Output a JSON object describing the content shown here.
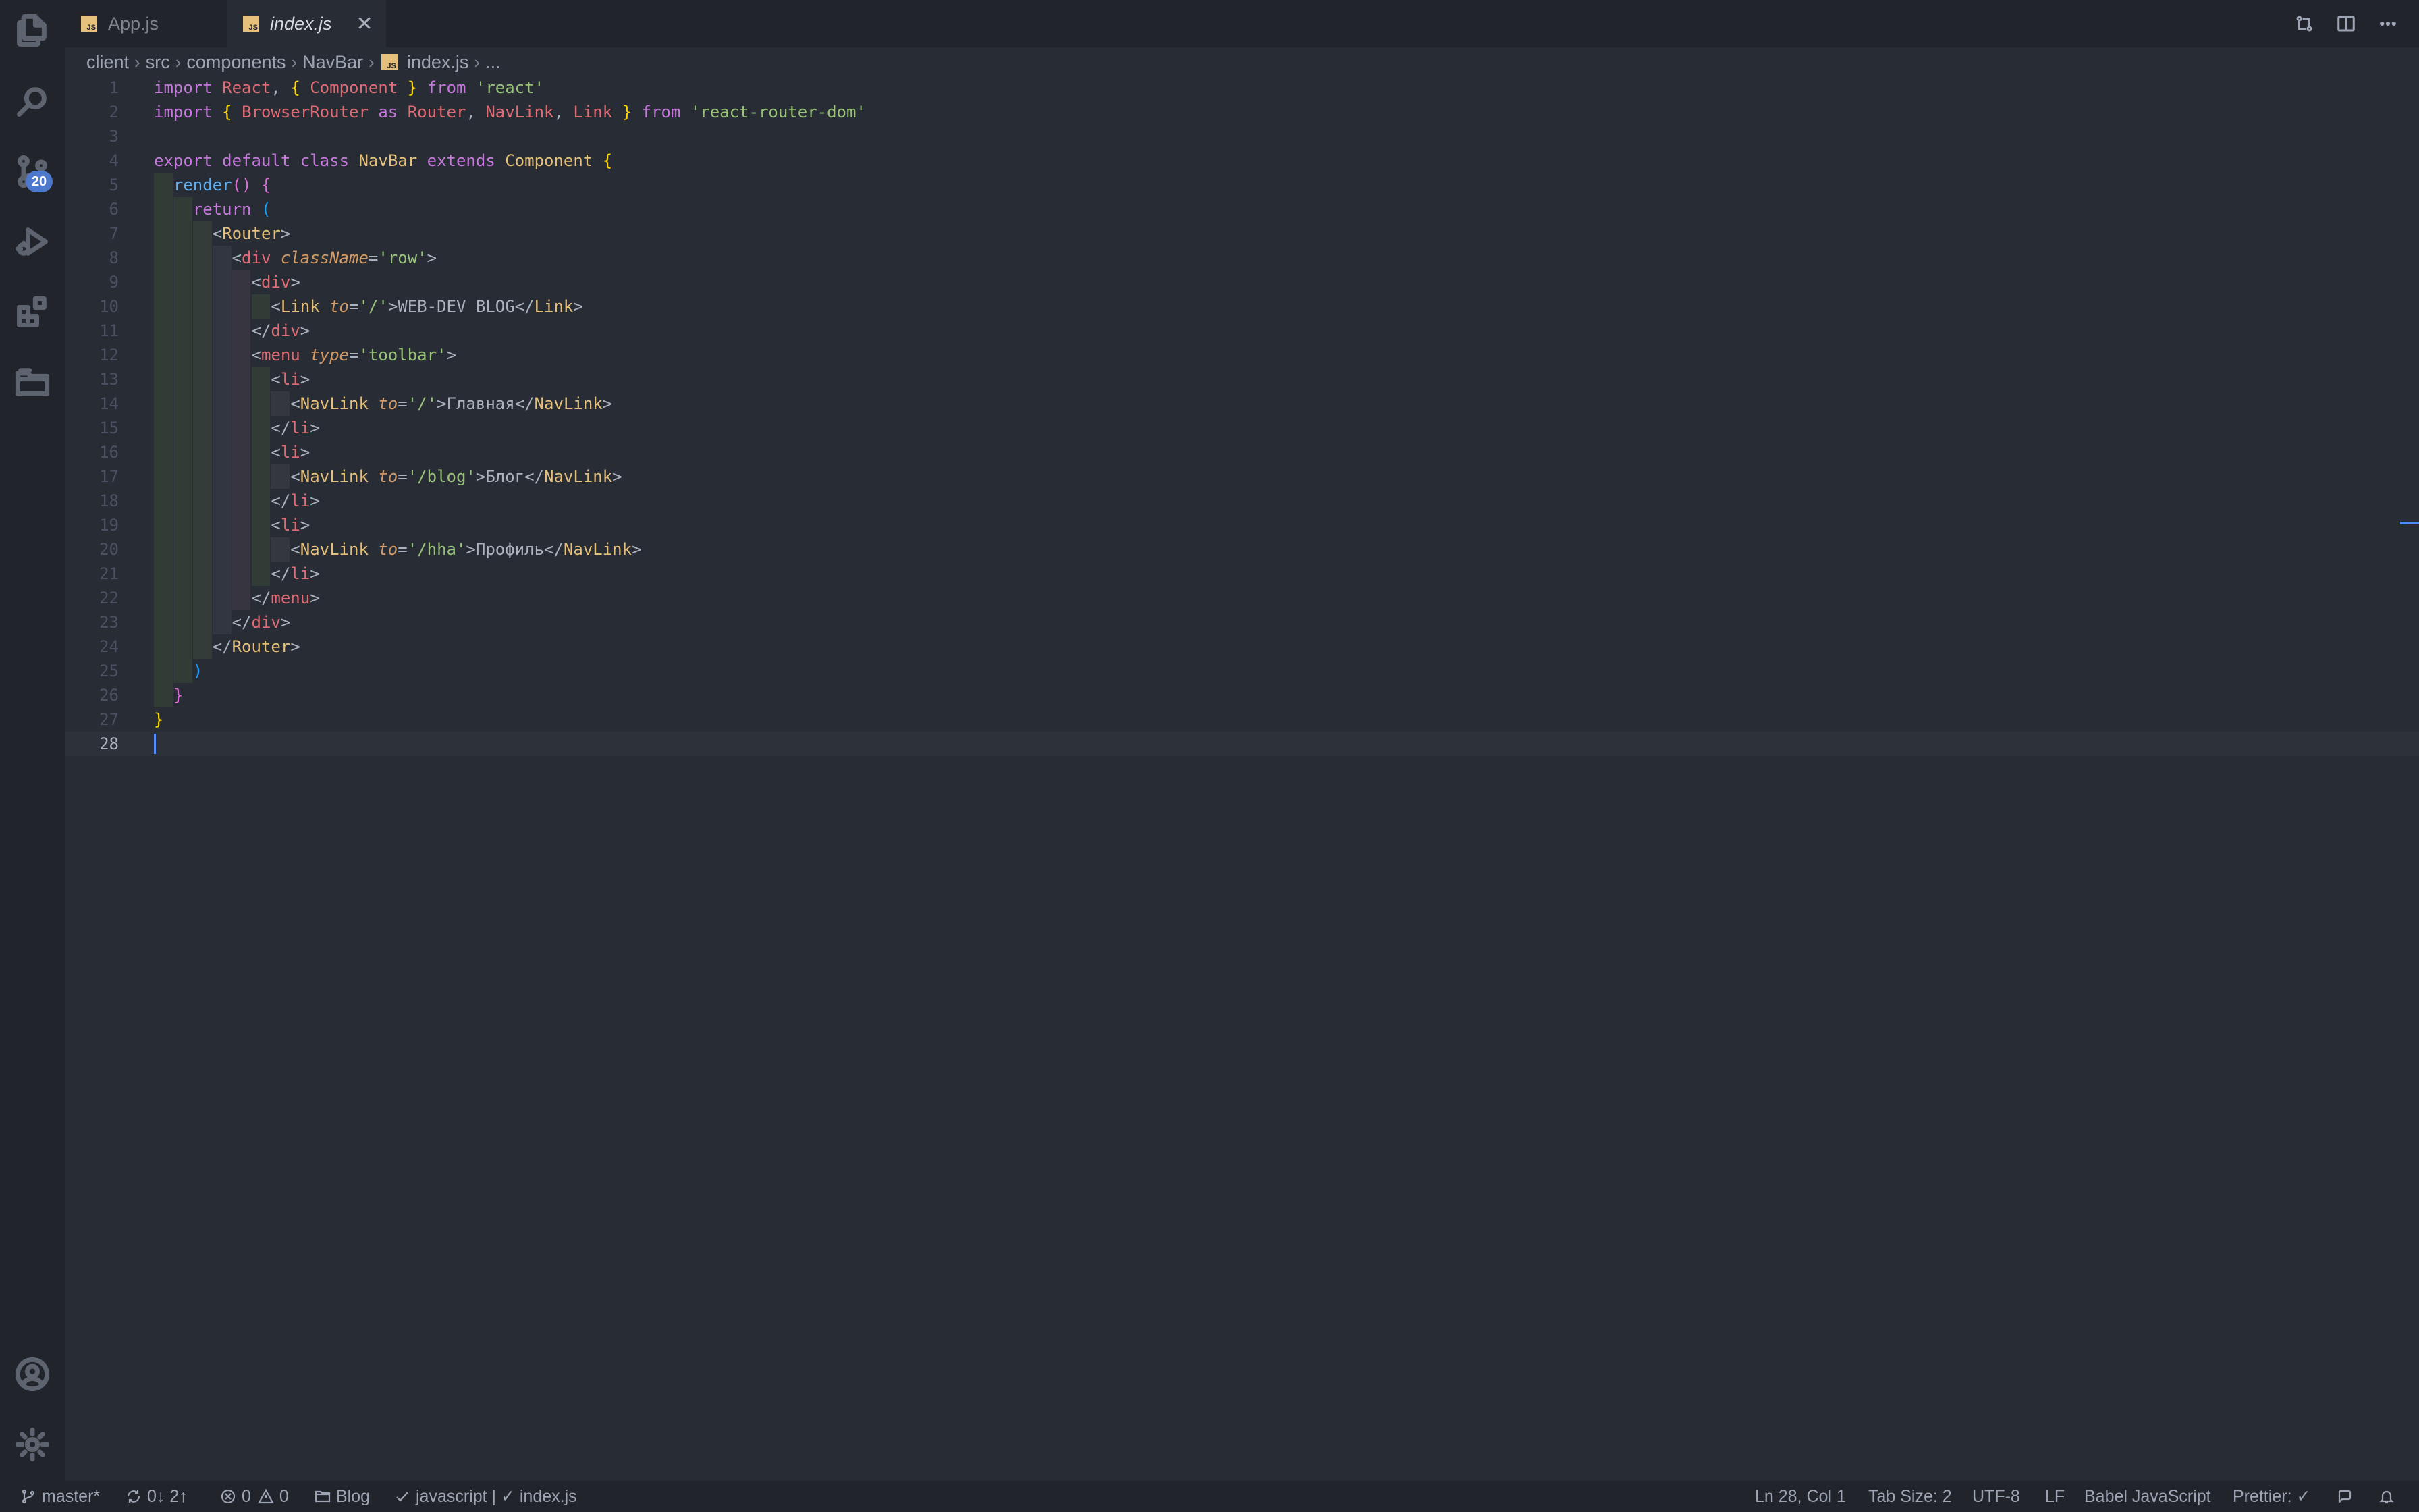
{
  "tabs": [
    {
      "label": "App.js",
      "icon": "js-file-icon",
      "active": false
    },
    {
      "label": "index.js",
      "icon": "js-file-icon",
      "active": true
    }
  ],
  "breadcrumb": [
    "client",
    "src",
    "components",
    "NavBar",
    "index.js",
    "..."
  ],
  "activity_bar": {
    "items": [
      "explorer-icon",
      "search-icon",
      "source-control-icon",
      "run-debug-icon",
      "extensions-icon",
      "project-manager-icon"
    ],
    "source_control_badge": "20",
    "bottom": [
      "account-icon",
      "settings-gear-icon"
    ]
  },
  "editor": {
    "line_numbers": [
      "1",
      "2",
      "3",
      "4",
      "5",
      "6",
      "7",
      "8",
      "9",
      "10",
      "11",
      "12",
      "13",
      "14",
      "15",
      "16",
      "17",
      "18",
      "19",
      "20",
      "21",
      "22",
      "23",
      "24",
      "25",
      "26",
      "27",
      "28"
    ],
    "lines": [
      [
        [
          "kw",
          "import"
        ],
        [
          "txt",
          " "
        ],
        [
          "var",
          "React"
        ],
        [
          "pun",
          ", "
        ],
        [
          "br1",
          "{"
        ],
        [
          "txt",
          " "
        ],
        [
          "var",
          "Component"
        ],
        [
          "txt",
          " "
        ],
        [
          "br1",
          "}"
        ],
        [
          "txt",
          " "
        ],
        [
          "kw",
          "from"
        ],
        [
          "txt",
          " "
        ],
        [
          "str",
          "'react'"
        ]
      ],
      [
        [
          "kw",
          "import"
        ],
        [
          "txt",
          " "
        ],
        [
          "br1",
          "{"
        ],
        [
          "txt",
          " "
        ],
        [
          "var",
          "BrowserRouter"
        ],
        [
          "txt",
          " "
        ],
        [
          "kw",
          "as"
        ],
        [
          "txt",
          " "
        ],
        [
          "var",
          "Router"
        ],
        [
          "pun",
          ", "
        ],
        [
          "var",
          "NavLink"
        ],
        [
          "pun",
          ", "
        ],
        [
          "var",
          "Link"
        ],
        [
          "txt",
          " "
        ],
        [
          "br1",
          "}"
        ],
        [
          "txt",
          " "
        ],
        [
          "kw",
          "from"
        ],
        [
          "txt",
          " "
        ],
        [
          "str",
          "'react-router-dom'"
        ]
      ],
      [],
      [
        [
          "kw",
          "export"
        ],
        [
          "txt",
          " "
        ],
        [
          "kw",
          "default"
        ],
        [
          "txt",
          " "
        ],
        [
          "kw",
          "class"
        ],
        [
          "txt",
          " "
        ],
        [
          "cls",
          "NavBar"
        ],
        [
          "txt",
          " "
        ],
        [
          "kw",
          "extends"
        ],
        [
          "txt",
          " "
        ],
        [
          "cls",
          "Component"
        ],
        [
          "txt",
          " "
        ],
        [
          "br1",
          "{"
        ]
      ],
      [
        [
          "txt",
          "  "
        ],
        [
          "fn",
          "render"
        ],
        [
          "br2",
          "()"
        ],
        [
          "txt",
          " "
        ],
        [
          "br2",
          "{"
        ]
      ],
      [
        [
          "txt",
          "    "
        ],
        [
          "kw",
          "return"
        ],
        [
          "txt",
          " "
        ],
        [
          "br3",
          "("
        ]
      ],
      [
        [
          "txt",
          "      "
        ],
        [
          "pun",
          "<"
        ],
        [
          "cls",
          "Router"
        ],
        [
          "pun",
          ">"
        ]
      ],
      [
        [
          "txt",
          "        "
        ],
        [
          "pun",
          "<"
        ],
        [
          "var",
          "div"
        ],
        [
          "txt",
          " "
        ],
        [
          "attr",
          "className"
        ],
        [
          "pun",
          "="
        ],
        [
          "str",
          "'row'"
        ],
        [
          "pun",
          ">"
        ]
      ],
      [
        [
          "txt",
          "          "
        ],
        [
          "pun",
          "<"
        ],
        [
          "var",
          "div"
        ],
        [
          "pun",
          ">"
        ]
      ],
      [
        [
          "txt",
          "            "
        ],
        [
          "pun",
          "<"
        ],
        [
          "cls",
          "Link"
        ],
        [
          "txt",
          " "
        ],
        [
          "attr",
          "to"
        ],
        [
          "pun",
          "="
        ],
        [
          "str",
          "'/'"
        ],
        [
          "pun",
          ">"
        ],
        [
          "txt",
          "WEB-DEV BLOG"
        ],
        [
          "pun",
          "</"
        ],
        [
          "cls",
          "Link"
        ],
        [
          "pun",
          ">"
        ]
      ],
      [
        [
          "txt",
          "          "
        ],
        [
          "pun",
          "</"
        ],
        [
          "var",
          "div"
        ],
        [
          "pun",
          ">"
        ]
      ],
      [
        [
          "txt",
          "          "
        ],
        [
          "pun",
          "<"
        ],
        [
          "var",
          "menu"
        ],
        [
          "txt",
          " "
        ],
        [
          "attr",
          "type"
        ],
        [
          "pun",
          "="
        ],
        [
          "str",
          "'toolbar'"
        ],
        [
          "pun",
          ">"
        ]
      ],
      [
        [
          "txt",
          "            "
        ],
        [
          "pun",
          "<"
        ],
        [
          "var",
          "li"
        ],
        [
          "pun",
          ">"
        ]
      ],
      [
        [
          "txt",
          "              "
        ],
        [
          "pun",
          "<"
        ],
        [
          "cls",
          "NavLink"
        ],
        [
          "txt",
          " "
        ],
        [
          "attr",
          "to"
        ],
        [
          "pun",
          "="
        ],
        [
          "str",
          "'/'"
        ],
        [
          "pun",
          ">"
        ],
        [
          "txt",
          "Главная"
        ],
        [
          "pun",
          "</"
        ],
        [
          "cls",
          "NavLink"
        ],
        [
          "pun",
          ">"
        ]
      ],
      [
        [
          "txt",
          "            "
        ],
        [
          "pun",
          "</"
        ],
        [
          "var",
          "li"
        ],
        [
          "pun",
          ">"
        ]
      ],
      [
        [
          "txt",
          "            "
        ],
        [
          "pun",
          "<"
        ],
        [
          "var",
          "li"
        ],
        [
          "pun",
          ">"
        ]
      ],
      [
        [
          "txt",
          "              "
        ],
        [
          "pun",
          "<"
        ],
        [
          "cls",
          "NavLink"
        ],
        [
          "txt",
          " "
        ],
        [
          "attr",
          "to"
        ],
        [
          "pun",
          "="
        ],
        [
          "str",
          "'/blog'"
        ],
        [
          "pun",
          ">"
        ],
        [
          "txt",
          "Блог"
        ],
        [
          "pun",
          "</"
        ],
        [
          "cls",
          "NavLink"
        ],
        [
          "pun",
          ">"
        ]
      ],
      [
        [
          "txt",
          "            "
        ],
        [
          "pun",
          "</"
        ],
        [
          "var",
          "li"
        ],
        [
          "pun",
          ">"
        ]
      ],
      [
        [
          "txt",
          "            "
        ],
        [
          "pun",
          "<"
        ],
        [
          "var",
          "li"
        ],
        [
          "pun",
          ">"
        ]
      ],
      [
        [
          "txt",
          "              "
        ],
        [
          "pun",
          "<"
        ],
        [
          "cls",
          "NavLink"
        ],
        [
          "txt",
          " "
        ],
        [
          "attr",
          "to"
        ],
        [
          "pun",
          "="
        ],
        [
          "str",
          "'/hha'"
        ],
        [
          "pun",
          ">"
        ],
        [
          "txt",
          "Профиль"
        ],
        [
          "pun",
          "</"
        ],
        [
          "cls",
          "NavLink"
        ],
        [
          "pun",
          ">"
        ]
      ],
      [
        [
          "txt",
          "            "
        ],
        [
          "pun",
          "</"
        ],
        [
          "var",
          "li"
        ],
        [
          "pun",
          ">"
        ]
      ],
      [
        [
          "txt",
          "          "
        ],
        [
          "pun",
          "</"
        ],
        [
          "var",
          "menu"
        ],
        [
          "pun",
          ">"
        ]
      ],
      [
        [
          "txt",
          "        "
        ],
        [
          "pun",
          "</"
        ],
        [
          "var",
          "div"
        ],
        [
          "pun",
          ">"
        ]
      ],
      [
        [
          "txt",
          "      "
        ],
        [
          "pun",
          "</"
        ],
        [
          "cls",
          "Router"
        ],
        [
          "pun",
          ">"
        ]
      ],
      [
        [
          "txt",
          "    "
        ],
        [
          "br3",
          ")"
        ]
      ],
      [
        [
          "txt",
          "  "
        ],
        [
          "br2",
          "}"
        ]
      ],
      [
        [
          "br1",
          "}"
        ]
      ],
      []
    ],
    "current_line": 28
  },
  "statusbar": {
    "branch": "master*",
    "sync": "0↓ 2↑",
    "errors": "0",
    "warnings": "0",
    "project": "Blog",
    "eslint": "javascript | ✓ index.js",
    "position": "Ln 28, Col 1",
    "tab_size": "Tab Size: 2",
    "encoding": "UTF-8",
    "eol": "LF",
    "language": "Babel JavaScript",
    "prettier": "Prettier: ✓"
  },
  "colors": {
    "editor_bg": "#282c34",
    "sidebar_bg": "#21252b",
    "accent": "#528bff",
    "badge": "#4d78cc",
    "keyword": "#c678dd",
    "variable": "#e06c75",
    "class": "#e5c07b",
    "string": "#98c379",
    "function": "#61afef",
    "attribute": "#d19a66"
  }
}
